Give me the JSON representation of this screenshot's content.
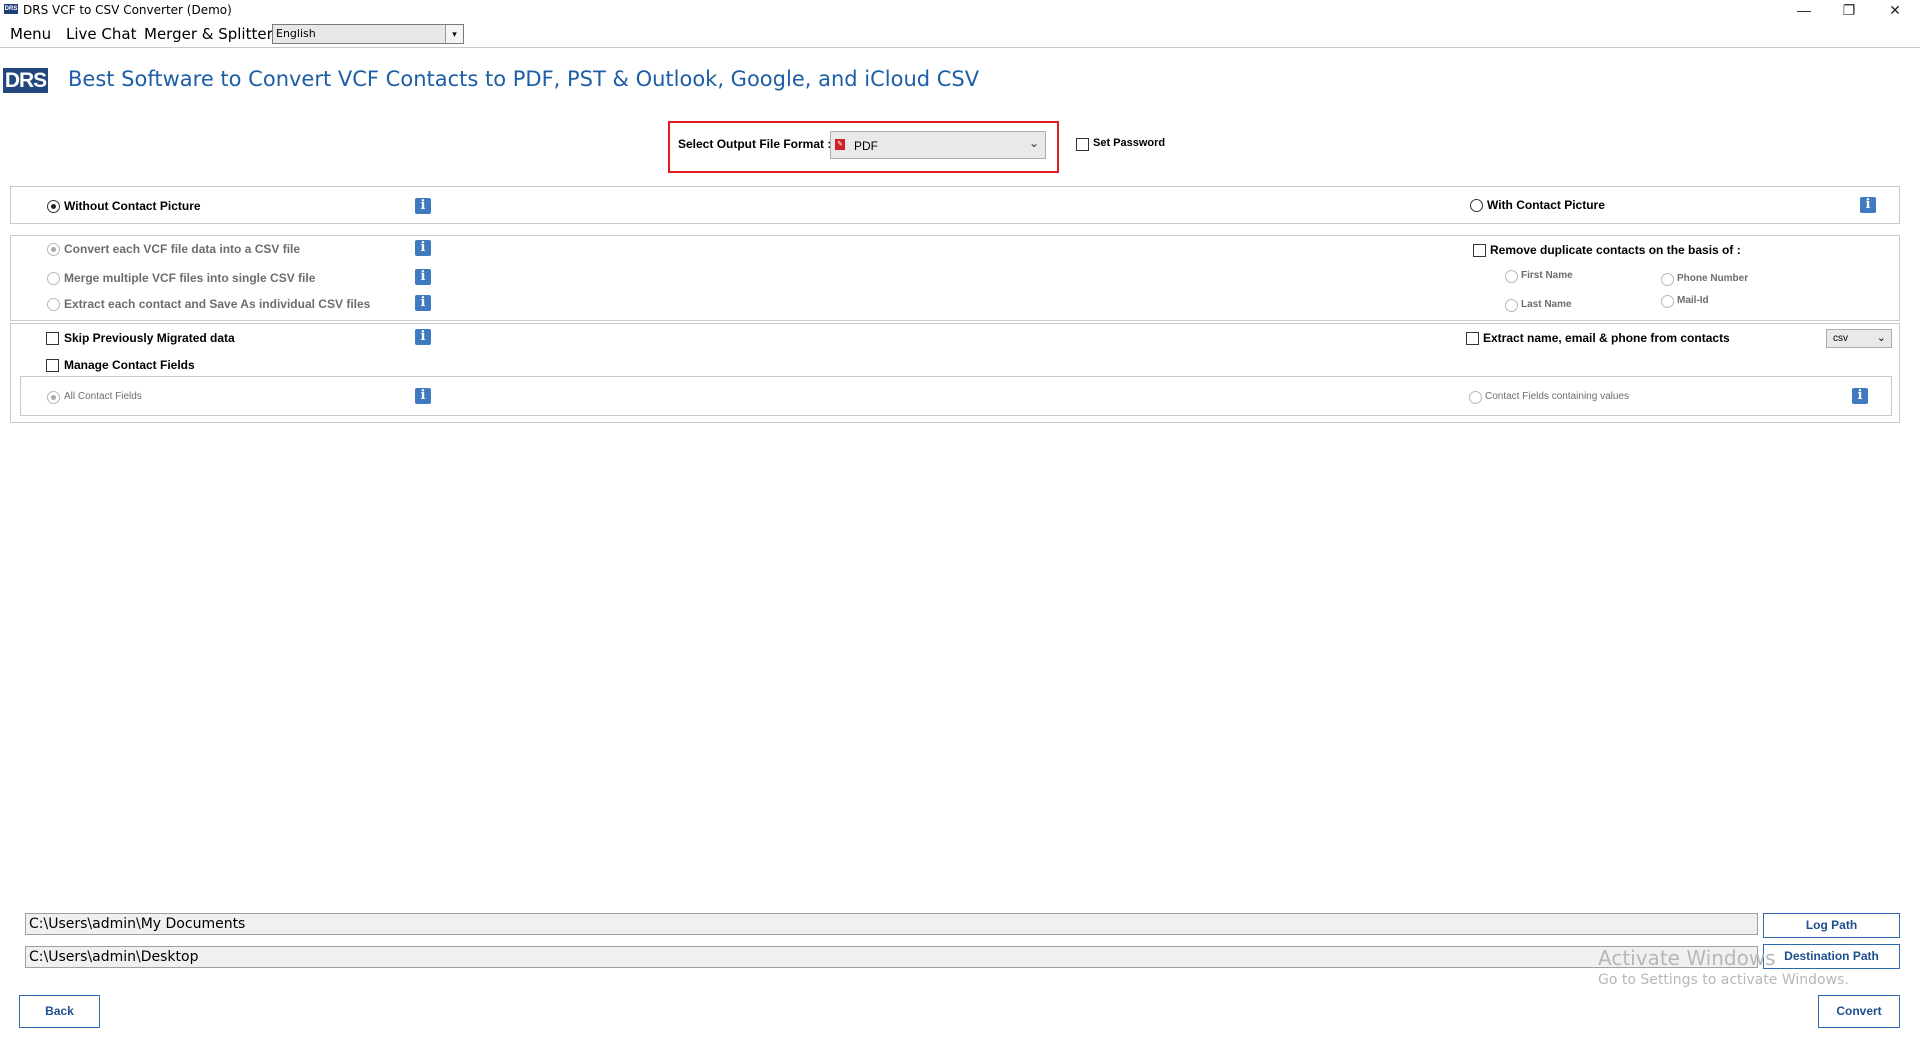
{
  "window": {
    "title": "DRS VCF to CSV Converter (Demo)",
    "icon_text": "DRS",
    "controls": {
      "minimize": "—",
      "restore": "❐",
      "close": "✕"
    }
  },
  "menu": {
    "items": [
      "Menu",
      "Live Chat",
      "Merger & Splitter"
    ],
    "language": "English"
  },
  "header": {
    "logo": "DRS",
    "headline": "Best Software to Convert VCF Contacts to PDF, PST & Outlook, Google, and iCloud CSV"
  },
  "format": {
    "label": "Select Output File Format :",
    "value": "PDF",
    "set_password_label": "Set Password"
  },
  "picture": {
    "without_label": "Without Contact Picture",
    "with_label": "With Contact Picture",
    "selected": "without"
  },
  "conversion": {
    "options": [
      "Convert each VCF file data into a CSV file",
      "Merge multiple VCF files into single CSV file",
      "Extract each contact and Save As individual CSV files"
    ],
    "remove_dup_label": "Remove duplicate contacts on the basis of :",
    "dup_options": [
      "First Name",
      "Phone Number",
      "Last Name",
      "Mail-Id"
    ]
  },
  "misc": {
    "skip_label": "Skip Previously Migrated data",
    "manage_label": "Manage Contact Fields",
    "extract_label": "Extract name, email & phone from contacts",
    "extract_format": "csv",
    "all_fields_label": "All Contact  Fields",
    "values_fields_label": "Contact Fields containing values"
  },
  "paths": {
    "log_path": "C:\\Users\\admin\\My Documents",
    "destination_path": "C:\\Users\\admin\\Desktop",
    "log_button": "Log Path",
    "destination_button": "Destination Path"
  },
  "footer": {
    "back": "Back",
    "convert": "Convert"
  },
  "watermark": {
    "line1": "Activate Windows",
    "line2": "Go to Settings to activate Windows."
  },
  "colors": {
    "accent": "#1d5ea6",
    "highlight_border": "#e21a23",
    "info_icon": "#3f79bf"
  }
}
